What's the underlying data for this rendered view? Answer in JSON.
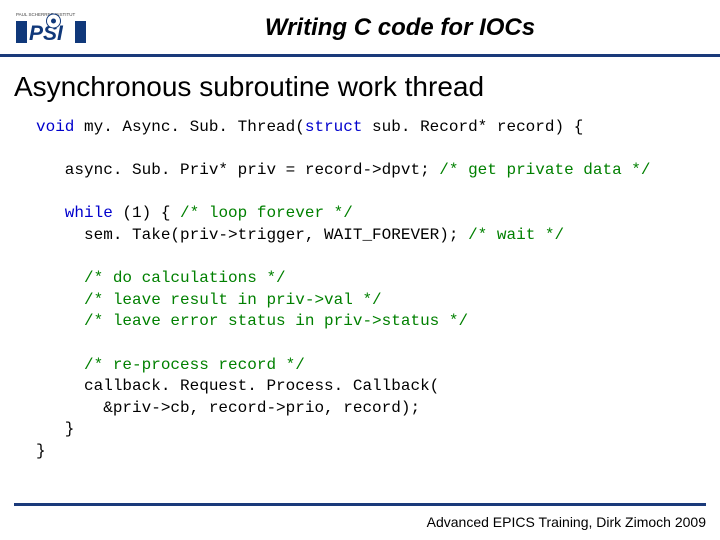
{
  "slide": {
    "title": "Writing C code for IOCs",
    "heading": "Asynchronous subroutine work thread",
    "logo_top": "PAUL SCHERRER INSTITUT",
    "logo_text": "PSI"
  },
  "code": {
    "l1a": "void",
    "l1b": " my. Async. Sub. Thread(",
    "l1c": "struct",
    "l1d": " sub. Record* record) {",
    "l2a": "   async. Sub. Priv* priv = record->dpvt; ",
    "l2b": "/* get private data */",
    "l3a": "   while",
    "l3b": " (1) { ",
    "l3c": "/* loop forever */",
    "l4a": "     sem. Take(priv->trigger, WAIT_FOREVER); ",
    "l4b": "/* wait */",
    "l5": "     /* do calculations */",
    "l6": "     /* leave result in priv->val */",
    "l7": "     /* leave error status in priv->status */",
    "l8": "     /* re-process record */",
    "l9": "     callback. Request. Process. Callback(",
    "l10": "       &priv->cb, record->prio, record);",
    "l11": "   }",
    "l12": "}"
  },
  "footer": {
    "text": "Advanced EPICS Training, Dirk Zimoch 2009"
  }
}
